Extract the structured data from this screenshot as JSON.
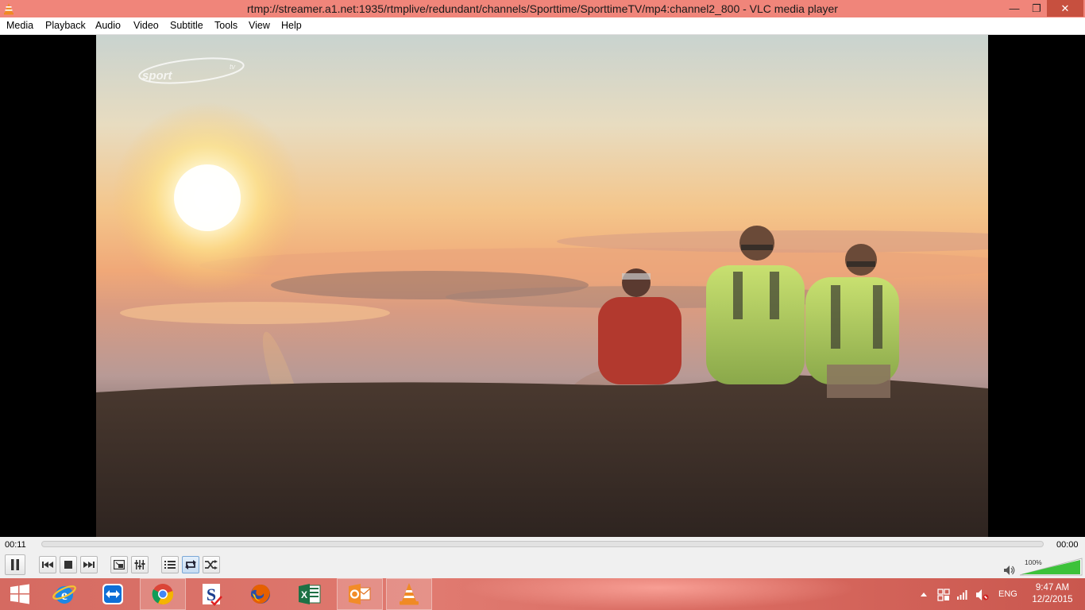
{
  "window": {
    "title": "rtmp://streamer.a1.net:1935/rtmplive/redundant/channels/Sporttime/SporttimeTV/mp4:channel2_800 - VLC media player",
    "buttons": {
      "minimize": "—",
      "maximize": "❐",
      "close": "✕"
    }
  },
  "menu": [
    "Media",
    "Playback",
    "Audio",
    "Video",
    "Subtitle",
    "Tools",
    "View",
    "Help"
  ],
  "video": {
    "content": "sunset-runners-on-mountain",
    "channel_logo_text": "sport",
    "channel_logo_suffix": "tv"
  },
  "playback": {
    "elapsed": "00:11",
    "remaining": "00:00",
    "progress": 0.0,
    "volume": "100%",
    "volume_level": 1.0
  },
  "controls": [
    {
      "name": "pause-button",
      "icon": "pause-icon"
    },
    {
      "name": "previous-button",
      "icon": "previous-icon"
    },
    {
      "name": "stop-button",
      "icon": "stop-icon"
    },
    {
      "name": "next-button",
      "icon": "next-icon"
    },
    {
      "name": "fullscreen-button",
      "icon": "fullscreen-icon"
    },
    {
      "name": "extended-settings-button",
      "icon": "equalizer-icon"
    },
    {
      "name": "playlist-button",
      "icon": "playlist-icon"
    },
    {
      "name": "loop-button",
      "icon": "loop-icon"
    },
    {
      "name": "shuffle-button",
      "icon": "shuffle-icon"
    }
  ],
  "taskbar": {
    "apps": [
      {
        "name": "start-button",
        "icon": "windows-icon"
      },
      {
        "name": "internet-explorer",
        "icon": "internet-explorer-icon"
      },
      {
        "name": "teamviewer",
        "icon": "teamviewer-icon"
      },
      {
        "name": "chrome",
        "icon": "chrome-icon"
      },
      {
        "name": "app-s",
        "icon": "s-app-icon"
      },
      {
        "name": "firefox",
        "icon": "firefox-icon"
      },
      {
        "name": "excel",
        "icon": "excel-icon"
      },
      {
        "name": "outlook",
        "icon": "outlook-icon"
      },
      {
        "name": "vlc",
        "icon": "vlc-icon"
      }
    ],
    "language": "ENG",
    "time": "9:47 AM",
    "date": "12/2/2015"
  },
  "colors": {
    "titlebar": "#f0857a",
    "close_button": "#c7503f",
    "taskbar": "#d56a61",
    "volume_fill": "#3cc23a"
  }
}
